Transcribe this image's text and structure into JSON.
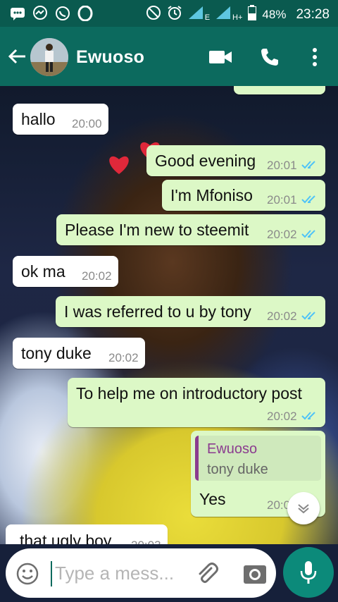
{
  "status_bar": {
    "battery": "48%",
    "time": "23:28",
    "network_label": "E",
    "network_label_2": "H+",
    "icons": [
      "chat-icon",
      "messenger-icon",
      "whatsapp-icon",
      "opera-icon",
      "do-not-disturb-icon",
      "alarm-icon",
      "signal-icon",
      "signal-icon",
      "battery-icon"
    ]
  },
  "header": {
    "title": "Ewuoso",
    "icons": [
      "back-arrow-icon",
      "video-call-icon",
      "phone-icon",
      "more-vert-icon"
    ]
  },
  "messages": [
    {
      "dir": "in",
      "text": "hallo",
      "time": "20:00"
    },
    {
      "dir": "out",
      "text": "Good evening",
      "time": "20:01"
    },
    {
      "dir": "out",
      "text": "I'm Mfoniso",
      "time": "20:01"
    },
    {
      "dir": "out",
      "text": "Please I'm new to steemit",
      "time": "20:02"
    },
    {
      "dir": "in",
      "text": "ok ma",
      "time": "20:02"
    },
    {
      "dir": "out",
      "text": "I was referred to u by tony",
      "time": "20:02"
    },
    {
      "dir": "in",
      "text": "tony duke",
      "time": "20:02"
    },
    {
      "dir": "out",
      "text": "To help me on introductory post",
      "time": "20:02"
    },
    {
      "dir": "out",
      "quote_name": "Ewuoso",
      "quote_text": "tony duke",
      "text": "Yes",
      "time": "20:03"
    },
    {
      "dir": "in",
      "text": "that ugly boy",
      "time": "20:03"
    }
  ],
  "composer": {
    "placeholder": "Type a mess...",
    "icons": [
      "emoji-icon",
      "attach-icon",
      "camera-icon",
      "mic-icon"
    ]
  },
  "colors": {
    "header": "#0c6a5e",
    "status_bar": "#0a5a4f",
    "outgoing_bubble": "#dcf8c6",
    "incoming_bubble": "#ffffff",
    "read_ticks": "#4fc3f7",
    "quote_name": "#8b3c8f",
    "mic_button": "#0c8a7a"
  }
}
